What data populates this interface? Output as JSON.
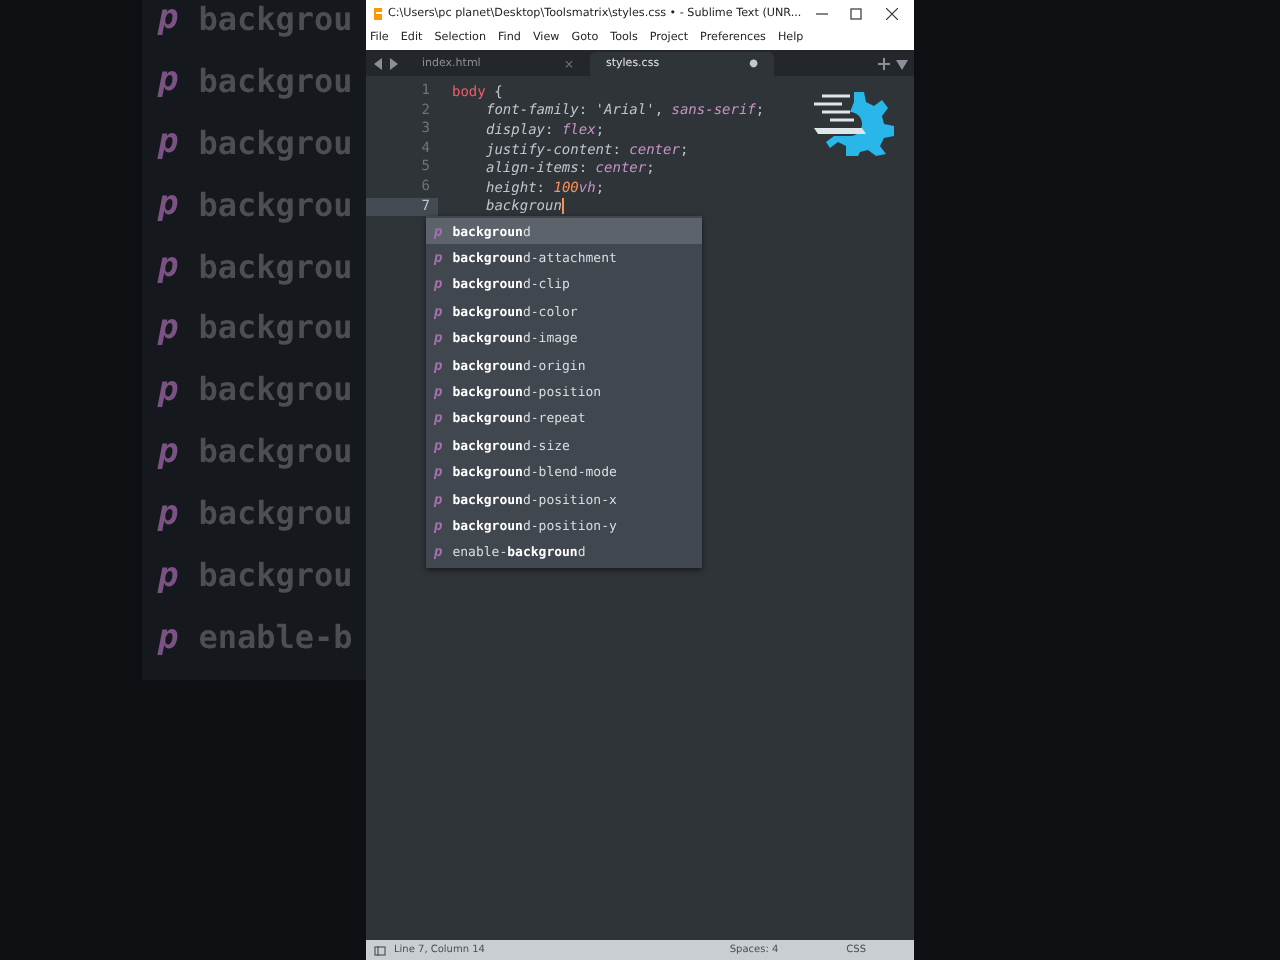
{
  "backdrop": {
    "rows": [
      {
        "icon": "p",
        "text": "backgrou"
      },
      {
        "icon": "p",
        "text": "backgrou"
      },
      {
        "icon": "p",
        "text": "backgrou"
      },
      {
        "icon": "p",
        "text": "backgrou"
      },
      {
        "icon": "p",
        "text": "backgrou"
      },
      {
        "icon": "p",
        "text": "backgrou"
      },
      {
        "icon": "p",
        "text": "backgrou"
      },
      {
        "icon": "p",
        "text": "backgrou"
      },
      {
        "icon": "p",
        "text": "backgrou"
      },
      {
        "icon": "p",
        "text": "backgrou"
      },
      {
        "icon": "p",
        "text": "enable-b"
      }
    ]
  },
  "window": {
    "title": "C:\\Users\\pc planet\\Desktop\\Toolsmatrix\\styles.css • - Sublime Text (UNR..."
  },
  "menu": [
    "File",
    "Edit",
    "Selection",
    "Find",
    "View",
    "Goto",
    "Tools",
    "Project",
    "Preferences",
    "Help"
  ],
  "tabs": [
    {
      "label": "index.html",
      "selected": false,
      "dirty": false,
      "mark": "×"
    },
    {
      "label": "styles.css",
      "selected": true,
      "dirty": true,
      "mark": "●"
    }
  ],
  "editor": {
    "lines": [
      {
        "number": "1",
        "current": false,
        "tokens": [
          {
            "kind": "selector",
            "text": "body"
          },
          {
            "kind": "punct",
            "text": " {"
          }
        ],
        "children": [
          {
            "number": "2",
            "current": false,
            "tokens": [
              {
                "kind": "property",
                "text": "font-family"
              },
              {
                "kind": "punct",
                "text": ": "
              },
              {
                "kind": "string",
                "text": "'Arial'"
              },
              {
                "kind": "punct",
                "text": ", "
              },
              {
                "kind": "value",
                "text": "sans-serif"
              },
              {
                "kind": "punct",
                "text": ";"
              }
            ]
          },
          {
            "number": "3",
            "current": false,
            "tokens": [
              {
                "kind": "property",
                "text": "display"
              },
              {
                "kind": "punct",
                "text": ": "
              },
              {
                "kind": "value",
                "text": "flex"
              },
              {
                "kind": "punct",
                "text": ";"
              }
            ]
          },
          {
            "number": "4",
            "current": false,
            "tokens": [
              {
                "kind": "property",
                "text": "justify-content"
              },
              {
                "kind": "punct",
                "text": ": "
              },
              {
                "kind": "value",
                "text": "center"
              },
              {
                "kind": "punct",
                "text": ";"
              }
            ]
          },
          {
            "number": "5",
            "current": false,
            "tokens": [
              {
                "kind": "property",
                "text": "align-items"
              },
              {
                "kind": "punct",
                "text": ": "
              },
              {
                "kind": "value",
                "text": "center"
              },
              {
                "kind": "punct",
                "text": ";"
              }
            ]
          },
          {
            "number": "6",
            "current": false,
            "tokens": [
              {
                "kind": "property",
                "text": "height"
              },
              {
                "kind": "punct",
                "text": ": "
              },
              {
                "kind": "number",
                "text": "100"
              },
              {
                "kind": "value",
                "text": "vh"
              },
              {
                "kind": "punct",
                "text": ";"
              }
            ]
          },
          {
            "number": "7",
            "current": true,
            "tokens": [
              {
                "kind": "property",
                "text": "backgroun"
              }
            ]
          }
        ]
      }
    ],
    "completions": [
      {
        "icon": "p",
        "text": "**backgroun**d",
        "selected": true
      },
      {
        "icon": "p",
        "text": "**backgroun**d-attachment",
        "selected": false
      },
      {
        "icon": "p",
        "text": "**backgroun**d-clip",
        "selected": false
      },
      {
        "icon": "p",
        "text": "**backgroun**d-color",
        "selected": false
      },
      {
        "icon": "p",
        "text": "**backgroun**d-image",
        "selected": false
      },
      {
        "icon": "p",
        "text": "**backgroun**d-origin",
        "selected": false
      },
      {
        "icon": "p",
        "text": "**backgroun**d-position",
        "selected": false
      },
      {
        "icon": "p",
        "text": "**backgroun**d-repeat",
        "selected": false
      },
      {
        "icon": "p",
        "text": "**backgroun**d-size",
        "selected": false
      },
      {
        "icon": "p",
        "text": "**backgroun**d-blend-mode",
        "selected": false
      },
      {
        "icon": "p",
        "text": "**backgroun**d-position-x",
        "selected": false
      },
      {
        "icon": "p",
        "text": "**backgroun**d-position-y",
        "selected": false
      },
      {
        "icon": "p",
        "text": "enable-**backgroun**d",
        "selected": false
      }
    ]
  },
  "status_bar": {
    "position": "Line 7, Column 14",
    "indentation": "Spaces: 4",
    "syntax": "CSS"
  }
}
